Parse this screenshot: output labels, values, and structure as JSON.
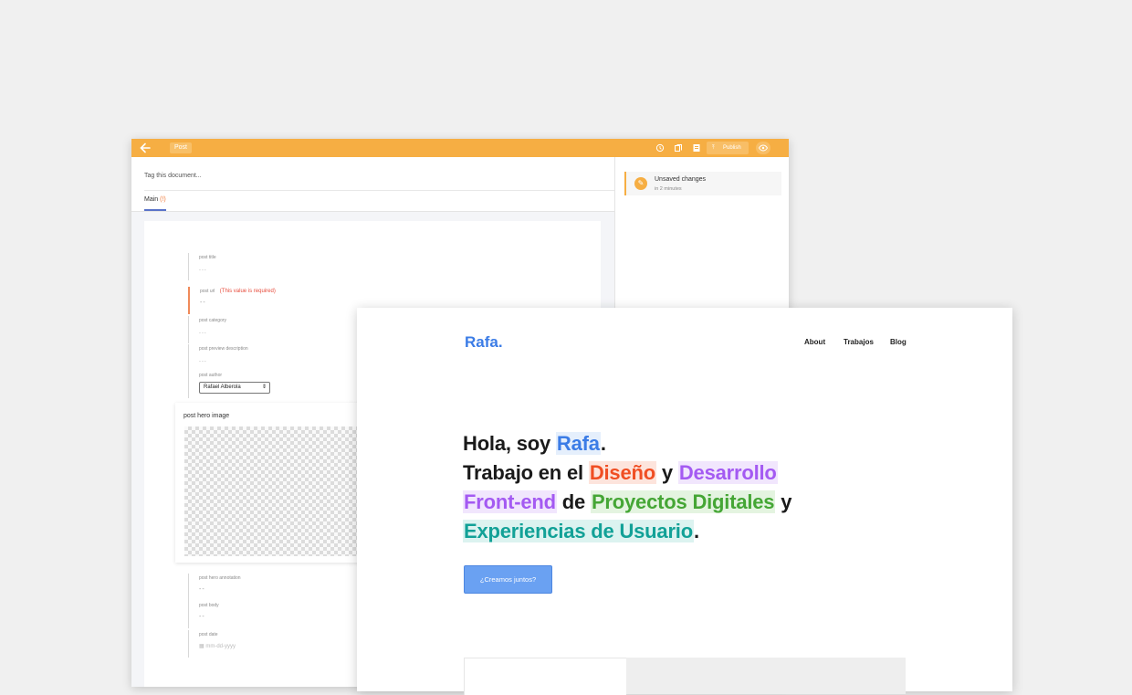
{
  "cms": {
    "tab_label": "Post",
    "tag_document": "Tag this document...",
    "main_tab": "Main",
    "main_tab_marker": "(!)",
    "publish_label": "Publish",
    "status_title": "Unsaved changes",
    "status_sub": "in 2 minutes",
    "fields": {
      "post_title": {
        "label": "post title",
        "value": "..."
      },
      "post_url": {
        "label": "post url",
        "error": "(This value is required)",
        "value": "--"
      },
      "post_category": {
        "label": "post category",
        "value": "..."
      },
      "post_preview": {
        "label": "post preview description",
        "value": "..."
      },
      "post_author": {
        "label": "post author",
        "value": "Rafael Alberola"
      },
      "post_hero_image": {
        "label": "post hero image"
      },
      "post_hero_annotation": {
        "label": "post hero annotation",
        "value": "--"
      },
      "post_body": {
        "label": "post body",
        "value": "--"
      },
      "post_date": {
        "label": "post date",
        "placeholder": "mm-dd-yyyy"
      }
    },
    "colors": {
      "topbar": "#f6ae43",
      "error": "#e74c3c"
    }
  },
  "site": {
    "logo": "Rafa.",
    "nav": [
      "About",
      "Trabajos",
      "Blog"
    ],
    "headline": {
      "l1_a": "Hola, soy ",
      "l1_name": "Rafa",
      "l1_end": ".",
      "l2_a": "Trabajo en el ",
      "l2_diseno": "Diseño",
      "l2_y": " y ",
      "l2_desarrollo": "Desarrollo",
      "l3_frontend": "Front-end",
      "l3_de": " de ",
      "l3_proyectos": "Proyectos Digitales",
      "l3_y": " y",
      "l4_experiencias": "Experiencias de Usuario",
      "l4_end": "."
    },
    "cta": "¿Creamos juntos?",
    "colors": {
      "blue": "#3b7ce6",
      "red": "#f04e23",
      "purple": "#a45af2",
      "green": "#45a635",
      "teal": "#12a197"
    }
  }
}
